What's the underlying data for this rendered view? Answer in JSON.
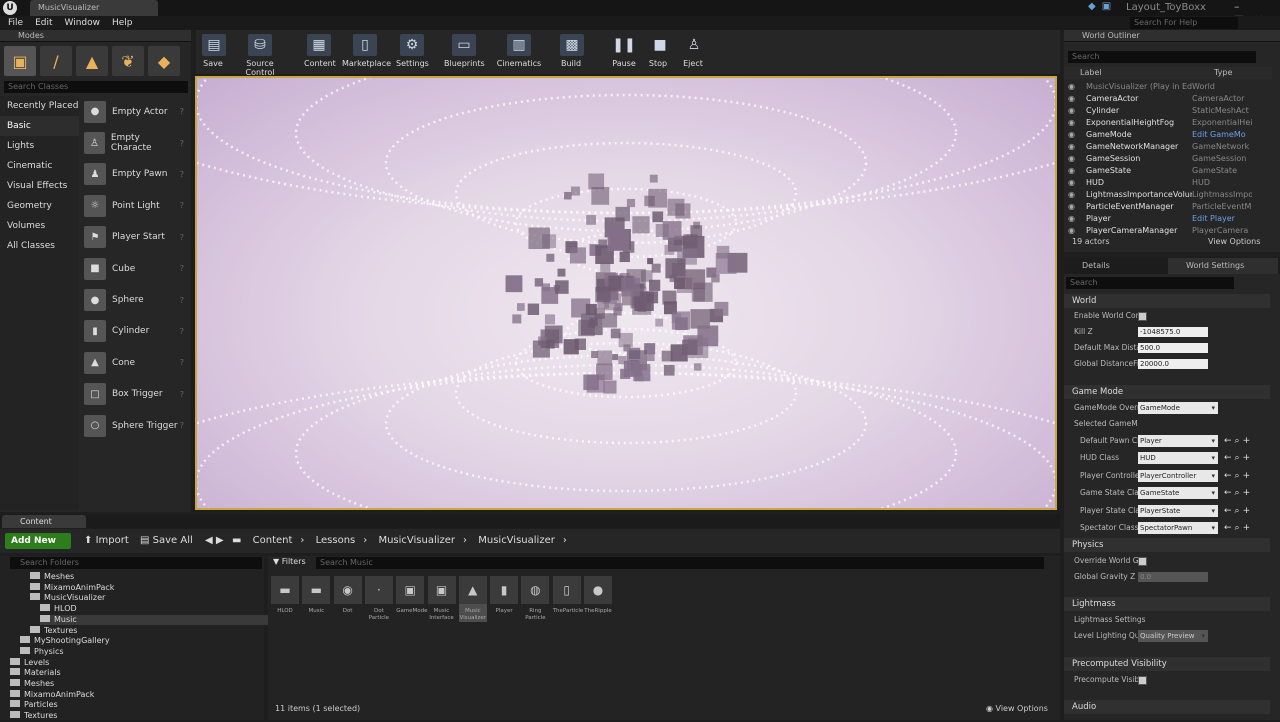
{
  "app": {
    "logo": "U",
    "doc_tab": "MusicVisualizer",
    "project": "Layout_ToyBoxx",
    "help_search_placeholder": "Search For Help",
    "menu": [
      "File",
      "Edit",
      "Window",
      "Help"
    ]
  },
  "modes": {
    "title": "Modes",
    "search_placeholder": "Search Classes",
    "categories": [
      "Recently Placed",
      "Basic",
      "Lights",
      "Cinematic",
      "Visual Effects",
      "Geometry",
      "Volumes",
      "All Classes"
    ],
    "selected_category": "Basic",
    "classes": [
      "Empty Actor",
      "Empty Characte",
      "Empty Pawn",
      "Point Light",
      "Player Start",
      "Cube",
      "Sphere",
      "Cylinder",
      "Cone",
      "Box Trigger",
      "Sphere Trigger"
    ]
  },
  "toolbar": {
    "buttons": [
      "Save",
      "Source Control",
      "Content",
      "Marketplace",
      "Settings",
      "Blueprints",
      "Cinematics",
      "Build",
      "Pause",
      "Stop",
      "Eject"
    ]
  },
  "outliner": {
    "title": "World Outliner",
    "search_placeholder": "Search",
    "col_label": "Label",
    "col_type": "Type",
    "rows": [
      {
        "label": "MusicVisualizer (Play in Editor)",
        "type": "World"
      },
      {
        "label": "CameraActor",
        "type": "CameraActor"
      },
      {
        "label": "Cylinder",
        "type": "StaticMeshAct"
      },
      {
        "label": "ExponentialHeightFog",
        "type": "ExponentialHei"
      },
      {
        "label": "GameMode",
        "type": "Edit GameMo"
      },
      {
        "label": "GameNetworkManager",
        "type": "GameNetwork"
      },
      {
        "label": "GameSession",
        "type": "GameSession"
      },
      {
        "label": "GameState",
        "type": "GameState"
      },
      {
        "label": "HUD",
        "type": "HUD"
      },
      {
        "label": "LightmassImportanceVolume",
        "type": "LightmassImpo"
      },
      {
        "label": "ParticleEventManager",
        "type": "ParticleEventM"
      },
      {
        "label": "Player",
        "type": "Edit Player"
      },
      {
        "label": "PlayerCameraManager",
        "type": "PlayerCamera"
      }
    ],
    "count": "19 actors",
    "view_options": "View Options"
  },
  "details": {
    "tab_details": "Details",
    "tab_world_settings": "World Settings",
    "search_placeholder": "Search",
    "sections": {
      "world": "World",
      "game_mode": "Game Mode",
      "selected_game_mode": "Selected GameM",
      "physics": "Physics",
      "lightmass": "Lightmass",
      "precomputed": "Precomputed Visibility",
      "audio": "Audio"
    },
    "world_props": [
      {
        "label": "Enable World Com",
        "value": ""
      },
      {
        "label": "Kill Z",
        "value": "-1048575.0"
      },
      {
        "label": "Default Max Dista",
        "value": "500.0"
      },
      {
        "label": "Global DistanceFi",
        "value": "20000.0"
      }
    ],
    "gamemode_override_label": "GameMode Overri",
    "gamemode_override_value": "GameMode",
    "selected_props": [
      {
        "label": "Default Pawn Cl",
        "value": "Player"
      },
      {
        "label": "HUD Class",
        "value": "HUD"
      },
      {
        "label": "Player Controlle",
        "value": "PlayerController"
      },
      {
        "label": "Game State Cla",
        "value": "GameState"
      },
      {
        "label": "Player State Cla",
        "value": "PlayerState"
      },
      {
        "label": "Spectator Class",
        "value": "SpectatorPawn"
      }
    ],
    "physics_props": [
      {
        "label": "Override World Gr",
        "value": ""
      },
      {
        "label": "Global Gravity Z",
        "value": "0.0"
      }
    ],
    "lightmass_settings": "Lightmass Settings",
    "level_lighting_label": "Level Lighting Qu",
    "level_lighting_value": "Quality Preview",
    "precompute_label": "Precompute Visib"
  },
  "content_browser": {
    "tab": "Content Browser",
    "add_new": "Add New",
    "import": "Import",
    "save_all": "Save All",
    "breadcrumb": [
      "Content",
      "Lessons",
      "MusicVisualizer",
      "MusicVisualizer"
    ],
    "folder_search_placeholder": "Search Folders",
    "folders": [
      {
        "name": "Meshes",
        "indent": 2
      },
      {
        "name": "MixamoAnimPack",
        "indent": 2
      },
      {
        "name": "MusicVisualizer",
        "indent": 2
      },
      {
        "name": "HLOD",
        "indent": 3
      },
      {
        "name": "Music",
        "indent": 3
      },
      {
        "name": "Textures",
        "indent": 2
      },
      {
        "name": "MyShootingGallery",
        "indent": 1
      },
      {
        "name": "Physics",
        "indent": 1
      },
      {
        "name": "Levels",
        "indent": 0
      },
      {
        "name": "Materials",
        "indent": 0
      },
      {
        "name": "Meshes",
        "indent": 0
      },
      {
        "name": "MixamoAnimPack",
        "indent": 0
      },
      {
        "name": "Particles",
        "indent": 0
      },
      {
        "name": "Textures",
        "indent": 0
      }
    ],
    "selected_folder": "Music",
    "filters": "Filters",
    "asset_search_placeholder": "Search Music",
    "assets": [
      "HLOD",
      "Music",
      "Dot",
      "Dot Particle",
      "GameMode",
      "Music Interface",
      "Music Visualizer",
      "Player",
      "Ring Particle",
      "TheParticle",
      "TheRipple"
    ],
    "selected_asset": "Music Visualizer",
    "item_count": "11 items (1 selected)",
    "view_options": "View Options"
  },
  "colors": {
    "accent_green": "#2e7d1c",
    "viewport_border": "#c9a740",
    "link_blue": "#6aa0e8"
  }
}
